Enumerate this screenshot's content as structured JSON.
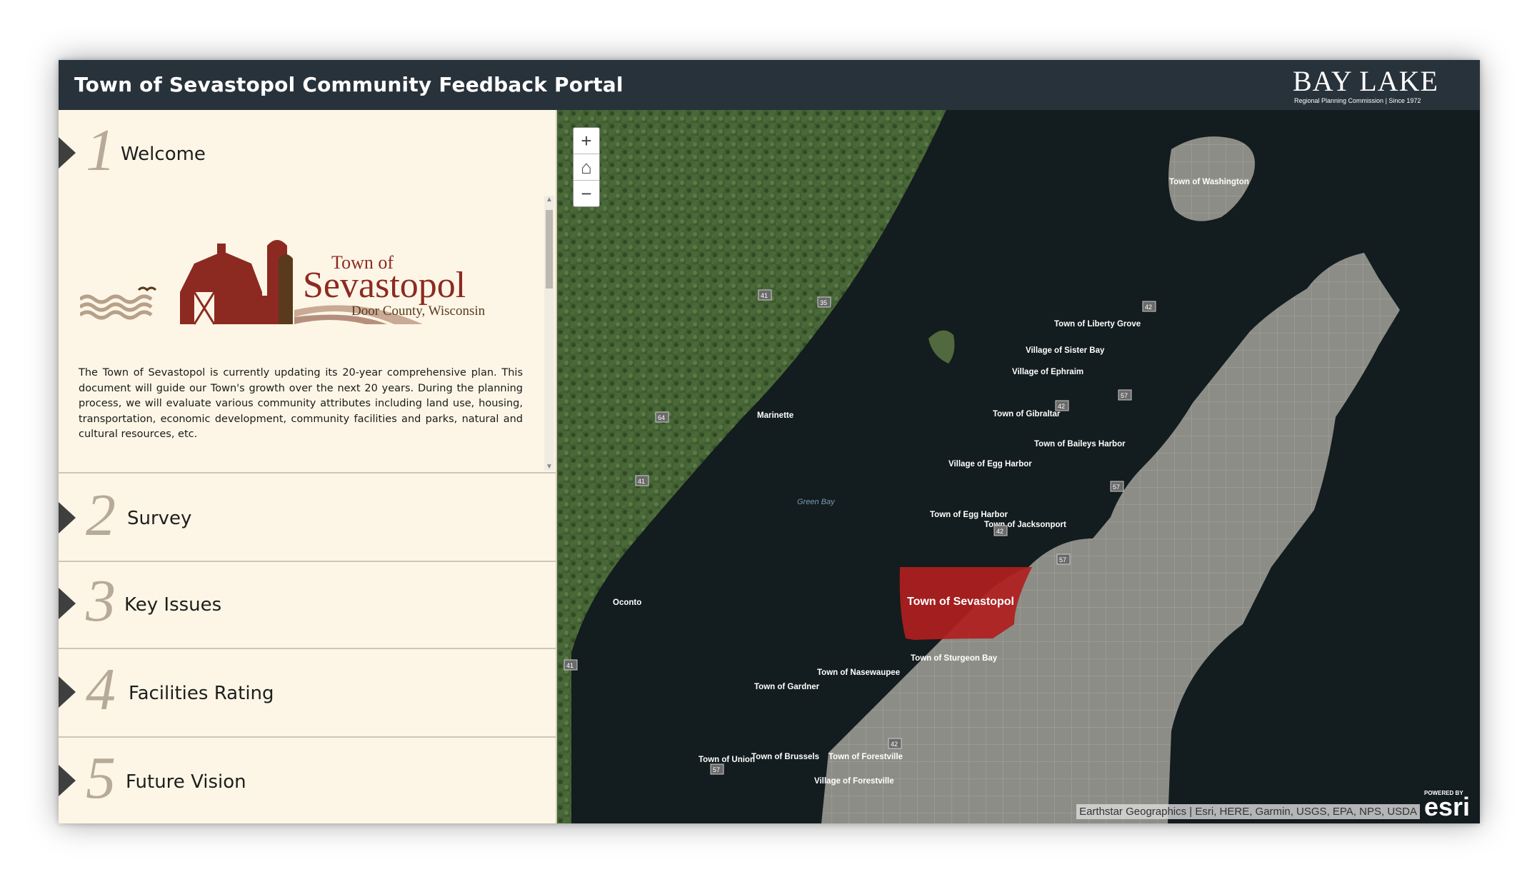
{
  "header": {
    "title": "Town of Sevastopol Community Feedback Portal",
    "logo_main": "BAY LAKE",
    "logo_sub": "Regional Planning    Commission | Since 1972"
  },
  "steps": [
    {
      "number": "1",
      "label": "Welcome"
    },
    {
      "number": "2",
      "label": "Survey"
    },
    {
      "number": "3",
      "label": "Key Issues"
    },
    {
      "number": "4",
      "label": "Facilities Rating"
    },
    {
      "number": "5",
      "label": "Future Vision"
    }
  ],
  "welcome": {
    "logo_line1": "Town of",
    "logo_line2": "Sevastopol",
    "logo_line3": "Door County, Wisconsin",
    "paragraph": "The Town of Sevastopol is currently updating its 20-year comprehensive plan. This document will guide our Town's growth over the next 20 years. During the planning process, we will evaluate various community attributes including land use, housing, transportation, economic development, community facilities and parks, natural and cultural resources, etc."
  },
  "map": {
    "zoom_in": "+",
    "home": "⌂",
    "zoom_out": "−",
    "attribution": "Earthstar Geographics | Esri, HERE, Garmin, USGS, EPA, NPS, USDA",
    "esri_powered": "POWERED BY",
    "esri_logo": "esri",
    "water_label": "Green Bay",
    "highlight_label": "Town of Sevastopol",
    "labels": {
      "washington": "Town of Washington",
      "liberty_grove": "Town of Liberty Grove",
      "sister_bay": "Village of Sister Bay",
      "ephraim": "Village of Ephraim",
      "gibraltar": "Town of Gibraltar",
      "baileys_harbor": "Town of Baileys Harbor",
      "egg_harbor_village": "Village of Egg Harbor",
      "egg_harbor_town": "Town of Egg Harbor",
      "jacksonport": "Town of Jacksonport",
      "sturgeon_bay": "Town of Sturgeon Bay",
      "nasewaupee": "Town of Nasewaupee",
      "gardner": "Town of Gardner",
      "union": "Town of Union",
      "brussels": "Town of Brussels",
      "forestville_town": "Town of Forestville",
      "forestville_village": "Village of Forestville",
      "marinette": "Marinette",
      "oconto": "Oconto"
    },
    "highways": [
      "41",
      "35",
      "64",
      "41",
      "41",
      "42",
      "57",
      "42",
      "57",
      "42",
      "57",
      "42",
      "57"
    ]
  },
  "colors": {
    "header_bg": "#28323b",
    "panel_bg": "#fdf6e6",
    "highlight": "#b01e1e",
    "logo_red": "#8c2a22",
    "logo_brown": "#5a3a1c"
  }
}
